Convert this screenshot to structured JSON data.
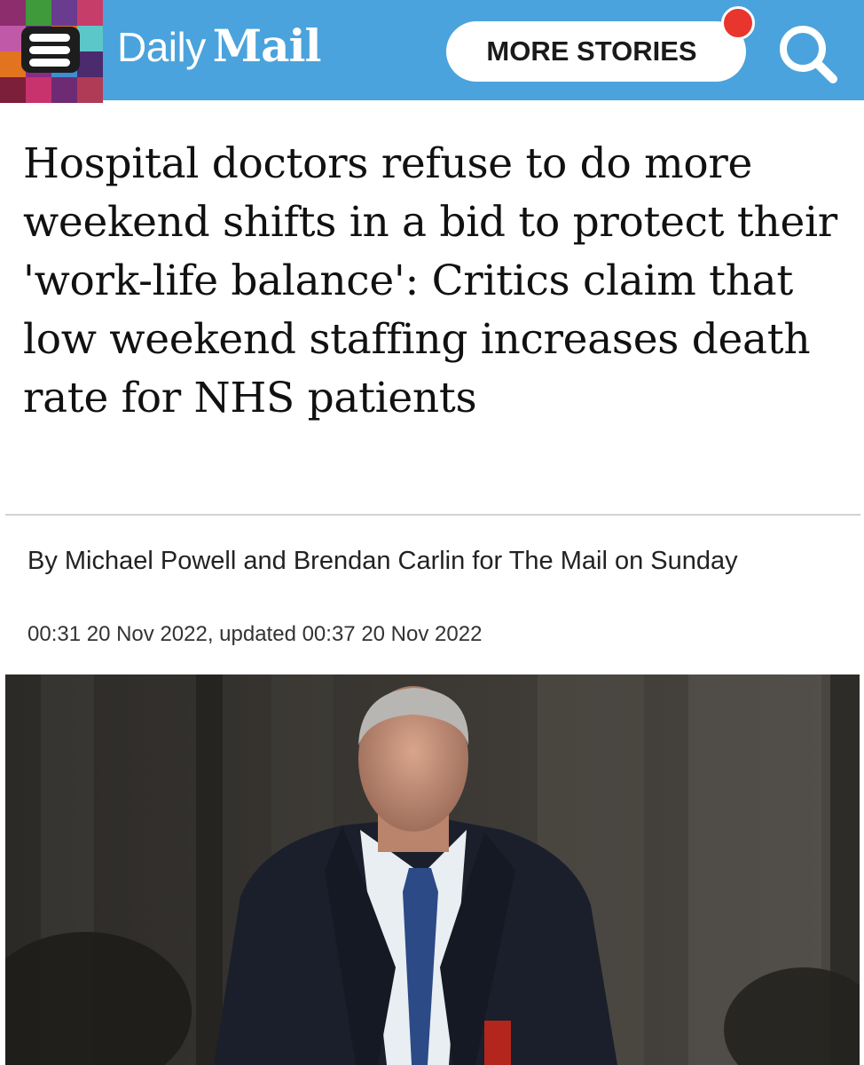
{
  "header": {
    "logo_daily": "Daily",
    "logo_mail": "Mail",
    "more_stories_label": "MORE STORIES",
    "accent_color": "#4aa3dc",
    "notification_color": "#e8352e",
    "menu_icon": "hamburger-menu-icon",
    "search_icon": "search-icon"
  },
  "article": {
    "headline": "Hospital doctors refuse to do more weekend shifts in a bid to protect their 'work-life balance': Critics claim that low weekend staffing increases death rate for NHS patients",
    "byline": "By Michael Powell and Brendan Carlin for The Mail on Sunday",
    "dateline": "00:31 20 Nov 2022, updated 00:37 20 Nov 2022"
  }
}
